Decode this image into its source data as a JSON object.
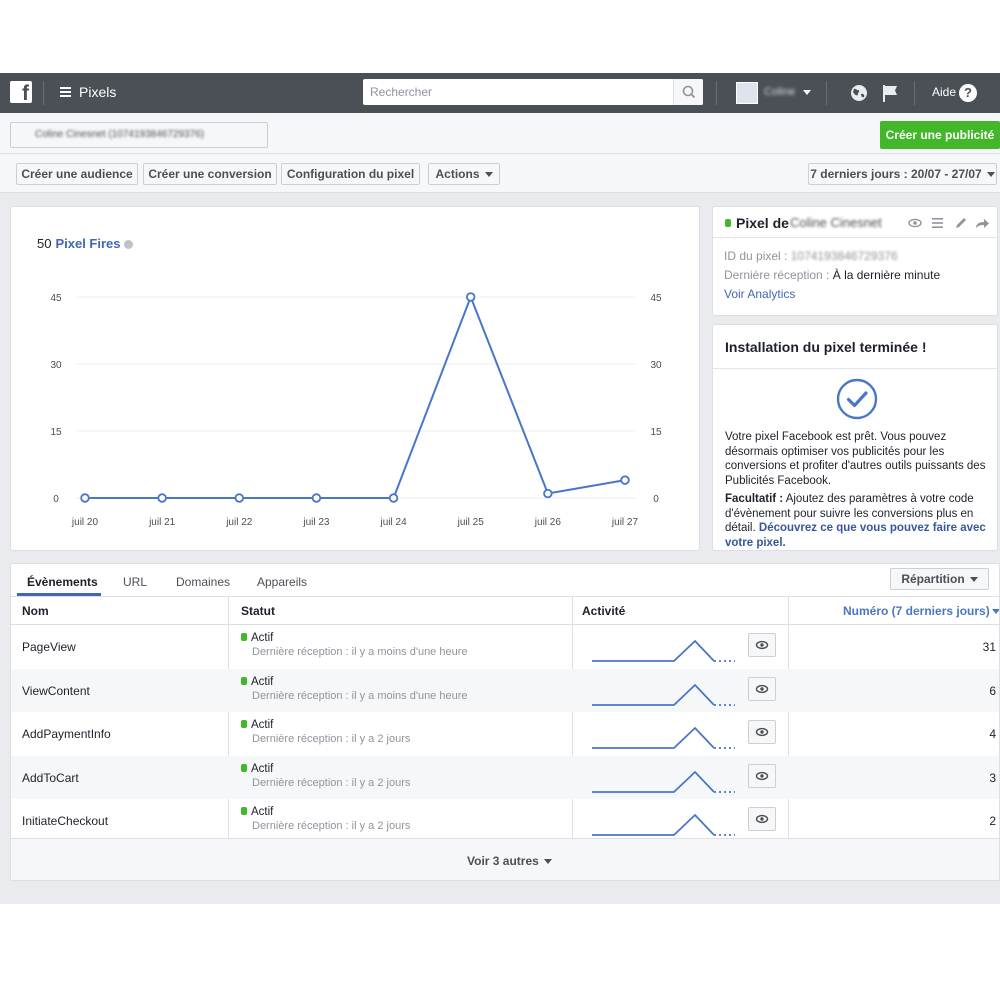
{
  "topbar": {
    "app_name": "Pixels",
    "search_placeholder": "Rechercher",
    "user_name": "Coline",
    "help_label": "Aide",
    "help_glyph": "?"
  },
  "account_bar": {
    "account_label": "Coline Cinesnet (1074193846729376)",
    "create_ad_label": "Créer une publicité"
  },
  "toolbar": {
    "create_audience": "Créer une audience",
    "create_conversion": "Créer une conversion",
    "pixel_config": "Configuration du pixel",
    "actions": "Actions",
    "date_range": "7 derniers jours : 20/07 - 27/07"
  },
  "chart": {
    "total": "50",
    "title": "Pixel Fires"
  },
  "chart_data": {
    "type": "line",
    "x": [
      "juil 20",
      "juil 21",
      "juil 22",
      "juil 23",
      "juil 24",
      "juil 25",
      "juil 26",
      "juil 27"
    ],
    "series": [
      {
        "values": [
          0,
          0,
          0,
          0,
          0,
          45,
          1,
          4
        ]
      }
    ],
    "yticks": [
      0,
      15,
      30,
      45
    ],
    "ylim": [
      0,
      45
    ],
    "title": "Pixel Fires",
    "grid": true,
    "color": "#4a76c8"
  },
  "pixel_card": {
    "title_prefix": "Pixel de",
    "owner": "Coline Cinesnet",
    "id_label": "ID du pixel :",
    "id_value": "1074193846729376",
    "last_label": "Dernière réception :",
    "last_value": "À la dernière minute",
    "analytics_link": "Voir Analytics"
  },
  "install_card": {
    "title": "Installation du pixel terminée !",
    "text1": "Votre pixel Facebook est prêt. Vous pouvez désormais optimiser vos publicités pour les conversions et profiter d'autres outils puissants des Publicités Facebook.",
    "optional_label": "Facultatif :",
    "text2": "Ajoutez des paramètres à votre code d'évènement pour suivre les conversions plus en détail.",
    "link": "Découvrez ce que vous pouvez faire avec votre pixel."
  },
  "tabs": [
    {
      "label": "Évènements"
    },
    {
      "label": "URL"
    },
    {
      "label": "Domaines"
    },
    {
      "label": "Appareils"
    }
  ],
  "repartition_label": "Répartition",
  "table": {
    "headers": {
      "name": "Nom",
      "status": "Statut",
      "activity": "Activité",
      "count": "Numéro (7 derniers jours)"
    },
    "rows": [
      {
        "name": "PageView",
        "status": "Actif",
        "last": "Dernière réception : il y a moins d'une heure",
        "count": "31"
      },
      {
        "name": "ViewContent",
        "status": "Actif",
        "last": "Dernière réception : il y a moins d'une heure",
        "count": "6"
      },
      {
        "name": "AddPaymentInfo",
        "status": "Actif",
        "last": "Dernière réception : il y a 2 jours",
        "count": "4"
      },
      {
        "name": "AddToCart",
        "status": "Actif",
        "last": "Dernière réception : il y a 2 jours",
        "count": "3"
      },
      {
        "name": "InitiateCheckout",
        "status": "Actif",
        "last": "Dernière réception : il y a 2 jours",
        "count": "2"
      }
    ],
    "see_more": "Voir 3 autres"
  },
  "colors": {
    "topbar": "#4b4f56",
    "accent": "#4267b2",
    "chart_line": "#4a76c8",
    "green": "#42b72a",
    "page_bg": "#e9ebee"
  },
  "icons": [
    "facebook-logo",
    "hamburger-icon",
    "search-icon",
    "globe-icon",
    "flag-icon",
    "help-icon",
    "eye-icon",
    "list-icon",
    "pencil-icon",
    "share-icon",
    "check-circle-icon",
    "info-icon"
  ]
}
